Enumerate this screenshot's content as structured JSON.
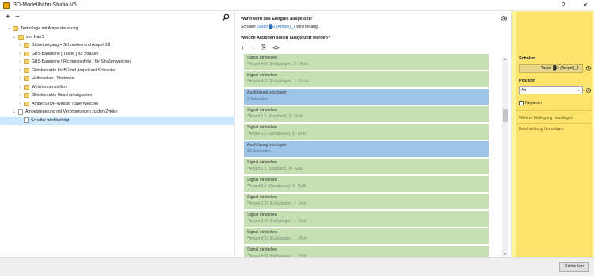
{
  "window": {
    "title": "3D-Modellbahn Studio V5",
    "help": "?",
    "close": "✕"
  },
  "left_toolbar": {
    "add": "+",
    "remove": "−"
  },
  "tree": [
    {
      "label": "Testanlage mit Ampelsteuerung",
      "indent": 0,
      "expander": "⌄",
      "kind": "folder"
    },
    {
      "label": "von HanS",
      "indent": 1,
      "expander": "⌄",
      "kind": "folder"
    },
    {
      "label": "Bahnübergang + Schranken und Ampel BÜ",
      "indent": 2,
      "expander": "›",
      "kind": "folder"
    },
    {
      "label": "GBS-Bausteine [ Taster ] für Straßen",
      "indent": 2,
      "expander": "›",
      "kind": "folder"
    },
    {
      "label": "GBS-Bausteine [ Richtungspfeile ] für Straßenweichen",
      "indent": 2,
      "expander": "›",
      "kind": "folder"
    },
    {
      "label": "Gleiskontakte für BÜ mit Ampel und Schranke",
      "indent": 2,
      "expander": "›",
      "kind": "folder"
    },
    {
      "label": "Haltestellen / Stationen",
      "indent": 2,
      "expander": "›",
      "kind": "folder"
    },
    {
      "label": "Weichen umstellen",
      "indent": 2,
      "expander": "›",
      "kind": "folder"
    },
    {
      "label": "Gleiskontakte Geschwindigkeiten",
      "indent": 2,
      "expander": "›",
      "kind": "folder"
    },
    {
      "label": "Ampel STOP-Weiche ( Sperrweiche)",
      "indent": 2,
      "expander": "›",
      "kind": "folder"
    },
    {
      "label": "Ampelsteuerung mit Verzögerungen zu den Zyklen",
      "indent": 1,
      "expander": "⌄",
      "kind": "doc"
    },
    {
      "label": "Schalter wird betätigt",
      "indent": 2,
      "expander": "",
      "kind": "doc",
      "selected": true
    }
  ],
  "middle": {
    "question_trigger": "Wann wird das Ereignis ausgelöst?",
    "trigger_prefix": "Schalter",
    "trigger_link": "Taster █D (Ampel)_1",
    "trigger_suffix": "wird betätigt.",
    "question_actions": "Welche Aktionen sollen ausgeführt werden?",
    "toolbar": {
      "add": "+",
      "remove": "−",
      "copy": "⎘",
      "code": "<>"
    },
    "actions": [
      {
        "title": "Signal einstellen",
        "detail": "*Ampel 4.01 (Fußgänger), 2 - Grün",
        "color": "green"
      },
      {
        "title": "Signal einstellen",
        "detail": "*Ampel 4.02 (Fußgänger), 2 - Grün",
        "color": "green"
      },
      {
        "title": "Ausführung verzögern",
        "detail": "3 Sekunden",
        "color": "blue"
      },
      {
        "title": "Signal einstellen",
        "detail": "*Ampel 1.0 (Standard), 3 - Grün",
        "color": "green"
      },
      {
        "title": "Signal einstellen",
        "detail": "*Ampel 3.0 (Geradeaus), 3 - Grün",
        "color": "green"
      },
      {
        "title": "Ausführung verzögern",
        "detail": "30 Sekunden",
        "color": "blue"
      },
      {
        "title": "Signal einstellen",
        "detail": "*Ampel 1.0 (Standard), 4 - Gelb",
        "color": "green"
      },
      {
        "title": "Signal einstellen",
        "detail": "*Ampel 3.0 (Geradeaus), 4 - Gelb",
        "color": "green"
      },
      {
        "title": "Signal einstellen",
        "detail": "*Ampel 2.01 (Fußgänger), 1 - Rot",
        "color": "green"
      },
      {
        "title": "Signal einstellen",
        "detail": "*Ampel 2.02 (Fußgänger), 1 - Rot",
        "color": "green"
      },
      {
        "title": "Signal einstellen",
        "detail": "*Ampel 4.01 (Fußgänger), 1 - Rot",
        "color": "green"
      },
      {
        "title": "Signal einstellen",
        "detail": "*Ampel 4.02 (Fußgänger), 1 - Rot",
        "color": "green"
      }
    ]
  },
  "right": {
    "switch_label": "Schalter",
    "switch_value": "Taster █D (Ampel)_1",
    "position_label": "Position",
    "position_value": "An",
    "negate_label": "Negieren",
    "add_condition": "Weitere Bedingung hinzufügen",
    "add_description": "Beschreibung hinzufügen"
  },
  "footer": {
    "close_button": "Schließen"
  },
  "colors": {
    "action_green": "#c6e0b4",
    "action_blue": "#9dc3e6",
    "panel_yellow": "#fce36b",
    "selected": "#cce8ff"
  }
}
